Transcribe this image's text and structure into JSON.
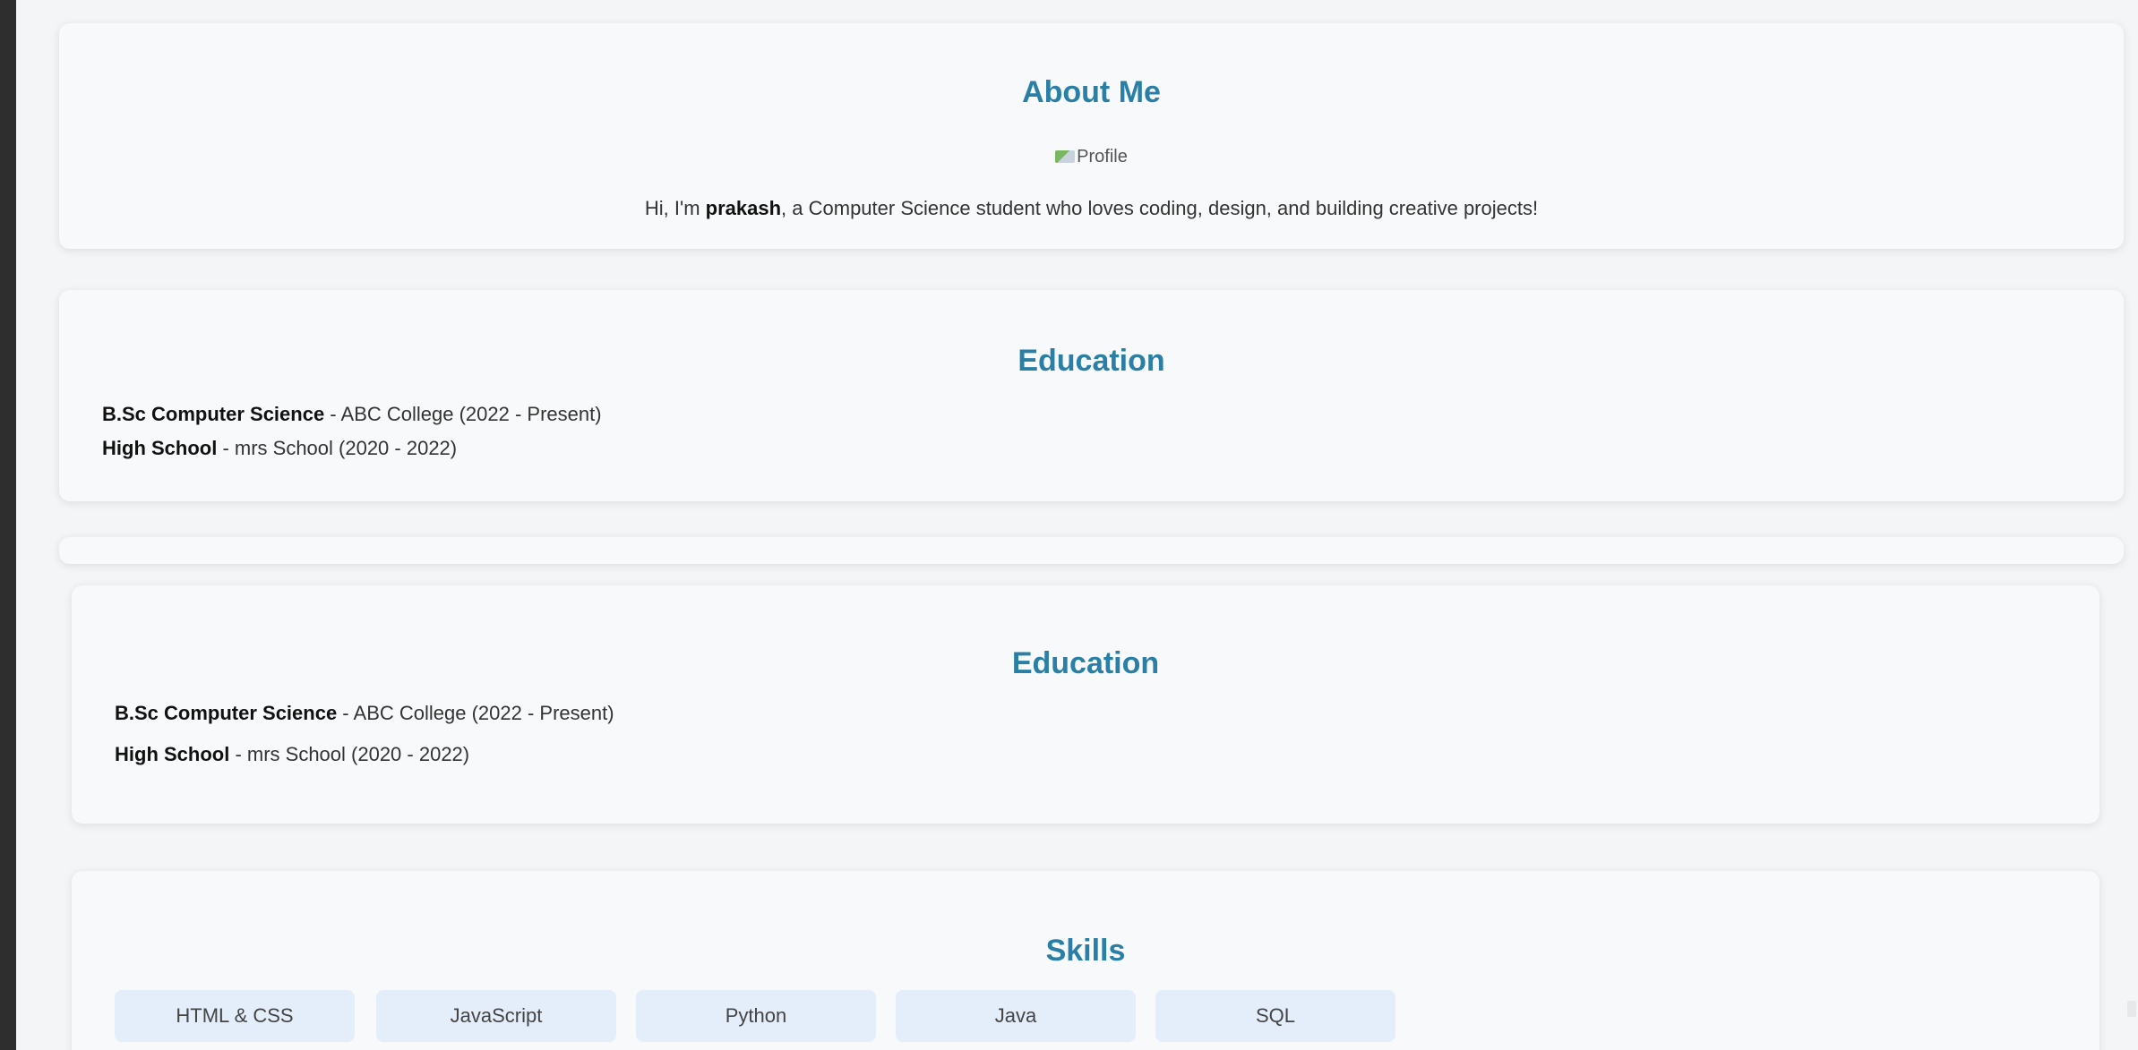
{
  "about": {
    "heading": "About Me",
    "profile_alt": "Profile",
    "intro_prefix": "Hi, I'm ",
    "name": "prakash",
    "intro_suffix": ", a Computer Science student who loves coding, design, and building creative projects!"
  },
  "education": {
    "heading": "Education",
    "entries": [
      {
        "degree": "B.Sc Computer Science",
        "detail": " - ABC College (2022 - Present)"
      },
      {
        "degree": "High School",
        "detail": " - mrs School (2020 - 2022)"
      }
    ]
  },
  "skills": {
    "heading": "Skills",
    "items": [
      "HTML & CSS",
      "JavaScript",
      "Python",
      "Java",
      "SQL"
    ]
  }
}
